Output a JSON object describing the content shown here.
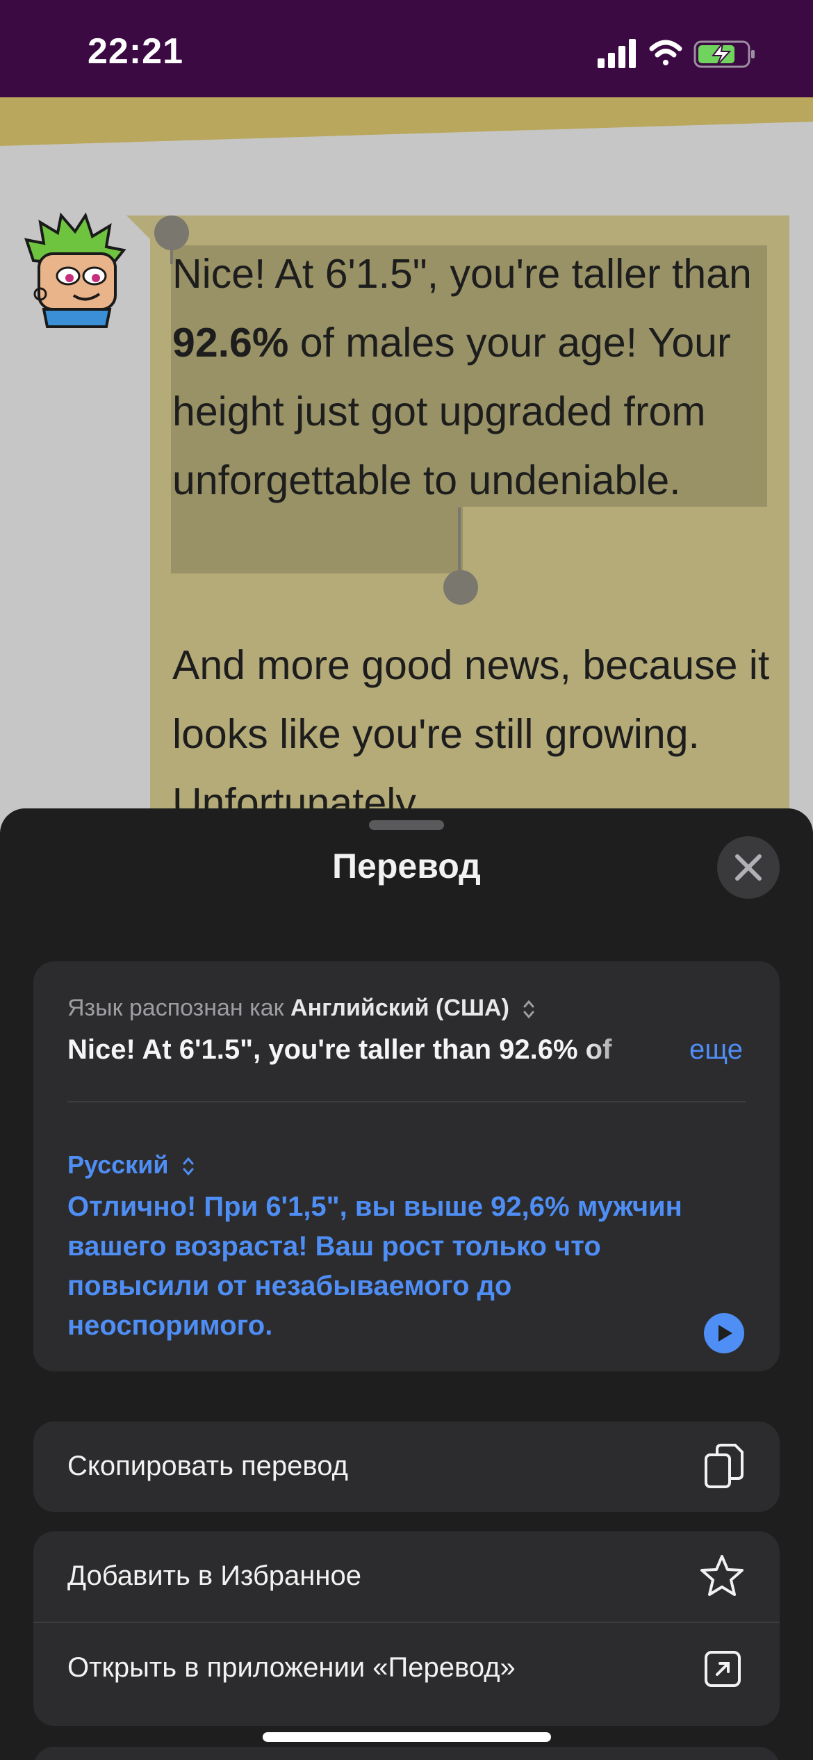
{
  "status_bar": {
    "time": "22:21"
  },
  "chat": {
    "message_1_part_a": "Nice! At 6'1.5\", you're taller than ",
    "message_1_bold": "92.6%",
    "message_1_part_b": " of males your age! Your height just got upgraded from unforgettable to undeniable.",
    "message_2": "And more good news, because it looks like you're still growing. Unfortunately,"
  },
  "sheet": {
    "title": "Перевод",
    "detected_prefix": "Язык распознан как",
    "detected_language": "Английский (США)",
    "source_text": "Nice! At 6'1.5\", you're taller than 92.6% of",
    "more_label": "еще",
    "target_language": "Русский",
    "translated_text": "Отлично! При 6'1,5\", вы выше 92,6% мужчин вашего возраста! Ваш рост только что повысили от незабываемого до неоспоримого.",
    "actions": {
      "copy": "Скопировать перевод",
      "favorite": "Добавить в Избранное",
      "open_app": "Открыть в приложении «Перевод»"
    }
  },
  "colors": {
    "status_bar_bg": "#3c0a42",
    "bubble": "#b5ab78",
    "accent_blue": "#4f8ef5",
    "sheet_bg": "#1e1e1f",
    "card_bg": "#2c2c2e"
  },
  "icons": [
    "signal-icon",
    "wifi-icon",
    "battery-charging-icon",
    "close-icon",
    "chevron-updown-icon",
    "play-icon",
    "copy-icon",
    "star-icon",
    "open-external-icon"
  ]
}
